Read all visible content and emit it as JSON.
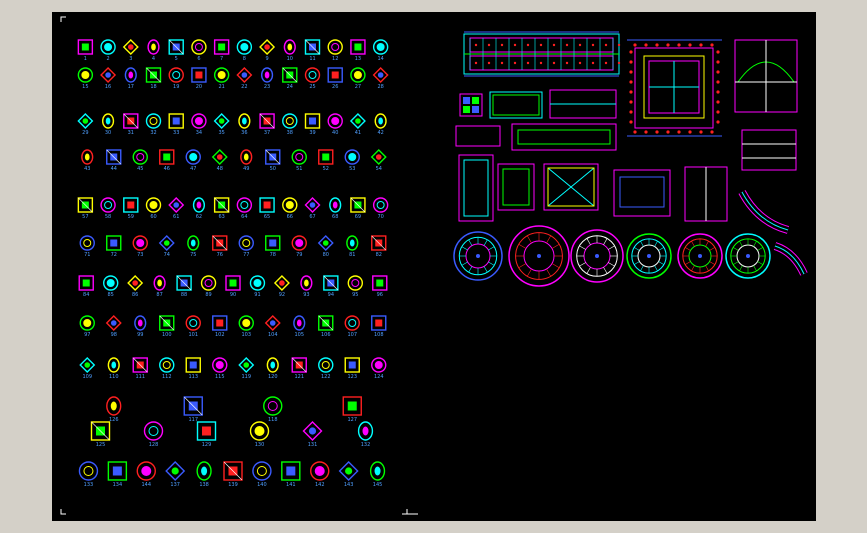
{
  "viewport": {
    "background": "#000000",
    "frame_color": "#d4d0c8"
  },
  "palette": {
    "magenta": "#ff00ff",
    "green": "#00ff00",
    "cyan": "#00ffff",
    "blue": "#3a5bff",
    "red": "#ff2020",
    "yellow": "#ffff00",
    "white": "#ffffff"
  },
  "left_sheet": {
    "item_numbers": [
      [
        "1",
        "2",
        "3",
        "4",
        "5",
        "6",
        "7",
        "8",
        "9",
        "10",
        "11",
        "12",
        "13",
        "14"
      ],
      [
        "15",
        "16",
        "17",
        "18",
        "19",
        "20",
        "21",
        "22",
        "23",
        "24",
        "25",
        "26",
        "27",
        "28"
      ],
      [
        "29",
        "30",
        "31",
        "32",
        "33",
        "34",
        "35",
        "36",
        "37",
        "38",
        "39",
        "40",
        "41",
        "42"
      ],
      [
        "43",
        "44",
        "45",
        "46",
        "47",
        "48",
        "49",
        "50",
        "51",
        "52",
        "53",
        "54"
      ],
      [
        "57",
        "58",
        "59",
        "60",
        "61",
        "62",
        "63",
        "64",
        "65",
        "66",
        "67",
        "68",
        "69",
        "70"
      ],
      [
        "71",
        "72",
        "73",
        "74",
        "75",
        "76",
        "77",
        "78",
        "79",
        "80",
        "81",
        "82"
      ],
      [
        "84",
        "85",
        "86",
        "87",
        "88",
        "89",
        "90",
        "91",
        "92",
        "93",
        "94",
        "95",
        "96"
      ],
      [
        "97",
        "98",
        "99",
        "100",
        "101",
        "102",
        "103",
        "104",
        "105",
        "106",
        "107",
        "108"
      ],
      [
        "109",
        "110",
        "111",
        "112",
        "113",
        "115",
        "119",
        "120",
        "121",
        "122",
        "123",
        "124"
      ],
      [
        "126",
        "117",
        "118",
        "127"
      ],
      [
        "125",
        "128",
        "129",
        "130",
        "131",
        "132"
      ],
      [
        "133",
        "134",
        "144",
        "137",
        "138",
        "139",
        "140",
        "141",
        "142",
        "143",
        "145"
      ]
    ]
  }
}
